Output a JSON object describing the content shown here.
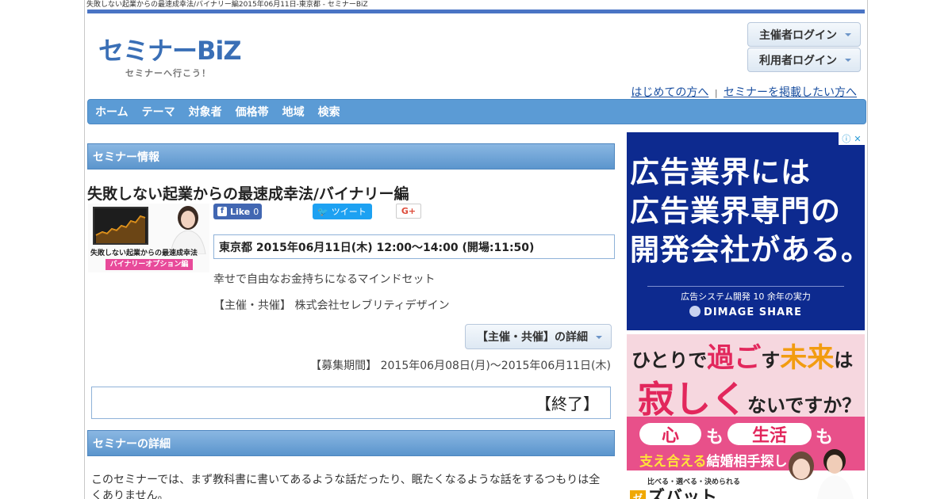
{
  "window": {
    "title": "失敗しない起業からの最速成幸法/バイナリー編2015年06月11日-東京都 - セミナーBiZ"
  },
  "logo": {
    "main": "セミナーBiZ",
    "tagline": "セミナーへ行こう！"
  },
  "login": {
    "owner_label": "主催者ログイン",
    "user_label": "利用者ログイン"
  },
  "top_links": {
    "first_time": "はじめての方へ",
    "separator": "|",
    "post_seminar": "セミナーを掲載したい方へ"
  },
  "nav": {
    "items": [
      "ホーム",
      "テーマ",
      "対象者",
      "価格帯",
      "地域",
      "検索"
    ]
  },
  "sections": {
    "info": "セミナー情報",
    "detail": "セミナーの詳細"
  },
  "seminar": {
    "title": "失敗しない起業からの最速成幸法/バイナリー編",
    "thumb_caption1": "失敗しない起業からの最速成幸法",
    "thumb_caption2": "バイナリーオプション編",
    "datetime": "東京都 2015年06月11日(木) 12:00～14:00 (開場:11:50)",
    "description": "幸せで自由なお金持ちになるマインドセット",
    "host": "【主催・共催】 株式会社セレブリティデザイン",
    "host_detail_button": "【主催・共催】の詳細",
    "period": "【募集期間】 2015年06月08日(月)～2015年06月11日(木)",
    "status": "【終了】",
    "body": "このセミナーでは、まず教科書に書いてあるような話だったり、眠たくなるような話をするつもりは全くありません。"
  },
  "social": {
    "facebook": {
      "label": "Like",
      "count": "0",
      "icon": "f"
    },
    "twitter": {
      "label": "ツイート",
      "icon": "🐦"
    },
    "gplus": {
      "label": "G+"
    }
  },
  "ads": {
    "ad1": {
      "line1": "広告業界には",
      "line2": "広告業界専門の",
      "line3": "開発会社がある。",
      "small": "広告システム開発 10 余年の実力",
      "brand": "DIMAGE SHARE",
      "choice_icons": [
        "ⓘ",
        "✕"
      ]
    },
    "ad2": {
      "h1_pre": "ひとりで",
      "h1_em1": "過ご",
      "h1_mid": "す",
      "h1_em2": "未来",
      "h1_post": "は",
      "h2_em": "寂しく",
      "h2_post": "ないですか？",
      "pill1": "心",
      "mo1": "も",
      "pill2": "生活",
      "mo2": "も",
      "sub_yellow": "支え合える",
      "sub_white": "結婚相手探し",
      "service": "比べる・選べる・決められる",
      "logo_mark": "ゼ",
      "logo": "ズバット"
    }
  },
  "colors": {
    "accent_bar": "#4a74c4",
    "nav": "#5b9bd5",
    "link": "#1a4fa0",
    "ad1_bg": "#0d2a8f",
    "ad2_pink": "#e8508a"
  }
}
